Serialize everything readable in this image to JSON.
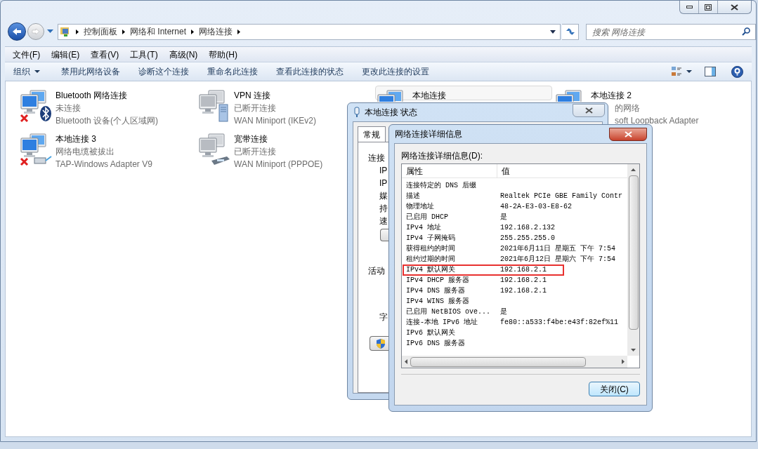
{
  "address_bar": {
    "breadcrumbs": [
      "控制面板",
      "网络和 Internet",
      "网络连接"
    ]
  },
  "search": {
    "placeholder": "搜索 网络连接"
  },
  "menu": [
    "文件(F)",
    "编辑(E)",
    "查看(V)",
    "工具(T)",
    "高级(N)",
    "帮助(H)"
  ],
  "toolbar": [
    {
      "label": "组织",
      "kind": "menu"
    },
    {
      "label": "禁用此网络设备",
      "kind": "button"
    },
    {
      "label": "诊断这个连接",
      "kind": "button"
    },
    {
      "label": "重命名此连接",
      "kind": "button"
    },
    {
      "label": "查看此连接的状态",
      "kind": "button"
    },
    {
      "label": "更改此连接的设置",
      "kind": "button"
    }
  ],
  "connections": [
    {
      "name": "Bluetooth 网络连接",
      "status": "未连接",
      "device": "Bluetooth 设备(个人区域网)",
      "enabled": true,
      "error": true,
      "kind": "bluetooth",
      "selected": false
    },
    {
      "name": "VPN 连接",
      "status": "已断开连接",
      "device": "WAN Miniport (IKEv2)",
      "enabled": false,
      "error": false,
      "kind": "server",
      "selected": false
    },
    {
      "name": "本地连接",
      "enabled": true,
      "error": false,
      "kind": "plain",
      "selected": true,
      "covered": true
    },
    {
      "name": "本地连接 2",
      "status": "的网络",
      "device": "soft Loopback Adapter",
      "enabled": true,
      "error": false,
      "kind": "plain",
      "selected": false,
      "covered": true
    },
    {
      "name": "本地连接 3",
      "status": "网络电缆被拔出",
      "device": "TAP-Windows Adapter V9",
      "enabled": true,
      "error": true,
      "kind": "cable",
      "selected": false
    },
    {
      "name": "宽带连接",
      "status": "已断开连接",
      "device": "WAN Miniport (PPPOE)",
      "enabled": false,
      "error": false,
      "kind": "modem",
      "selected": false
    }
  ],
  "status_dialog": {
    "title": "本地连接 状态",
    "tabs": [
      {
        "label": "常规",
        "selected": true
      }
    ],
    "sections": [
      {
        "heading": "连接",
        "fields": [
          "IP",
          "IP",
          "媒",
          "持",
          "速"
        ]
      },
      {
        "heading": "活动",
        "fields": [
          "字"
        ]
      }
    ]
  },
  "details_dialog": {
    "title": "网络连接详细信息",
    "label": "网络连接详细信息(D):",
    "columns": [
      "属性",
      "值"
    ],
    "rows": [
      {
        "property": "连接特定的 DNS 后缀",
        "highlighted": false
      },
      {
        "property": "描述",
        "value": "Realtek PCIe GBE Family Contr",
        "highlighted": false
      },
      {
        "property": "物理地址",
        "value": "48-2A-E3-03-E8-62",
        "highlighted": false
      },
      {
        "property": "已启用 DHCP",
        "value": "是",
        "highlighted": false
      },
      {
        "property": "IPv4 地址",
        "value": "192.168.2.132",
        "highlighted": false
      },
      {
        "property": "IPv4 子网掩码",
        "value": "255.255.255.0",
        "highlighted": false
      },
      {
        "property": "获得租约的时间",
        "value": "2021年6月11日 星期五 下午 7:54",
        "highlighted": false
      },
      {
        "property": "租约过期的时间",
        "value": "2021年6月12日 星期六 下午 7:54",
        "highlighted": false
      },
      {
        "property": "IPv4 默认网关",
        "value": "192.168.2.1",
        "highlighted": true
      },
      {
        "property": "IPv4 DHCP 服务器",
        "value": "192.168.2.1",
        "highlighted": false
      },
      {
        "property": "IPv4 DNS 服务器",
        "value": "192.168.2.1",
        "highlighted": false
      },
      {
        "property": "IPv4 WINS 服务器",
        "highlighted": false
      },
      {
        "property": "已启用 NetBIOS ove...",
        "value": "是",
        "highlighted": false
      },
      {
        "property": "连接-本地 IPv6 地址",
        "value": "fe80::a533:f4be:e43f:82ef%11",
        "highlighted": false
      },
      {
        "property": "IPv6 默认网关",
        "highlighted": false
      },
      {
        "property": "IPv6 DNS 服务器",
        "highlighted": false
      }
    ],
    "close_button": "关闭(C)"
  }
}
